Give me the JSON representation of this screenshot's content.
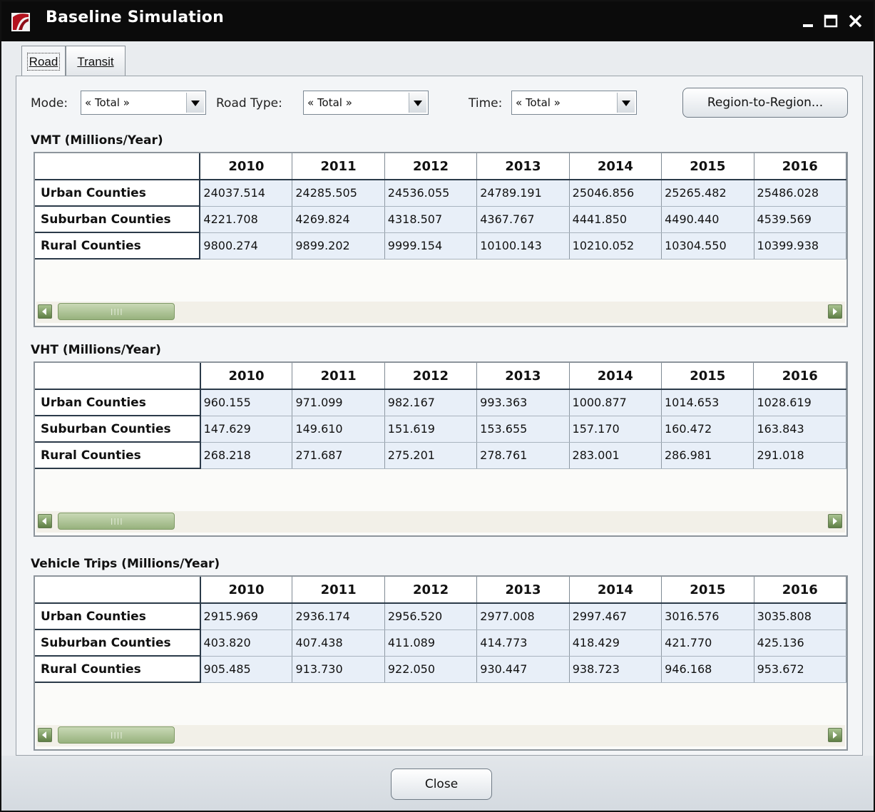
{
  "window": {
    "title": "Baseline Simulation",
    "icon": "app-logo-icon",
    "controls": [
      "minimize-icon",
      "maximize-icon",
      "close-icon"
    ],
    "accent_color": "#0b0b0b"
  },
  "tabs": [
    {
      "label": "Road",
      "active": true
    },
    {
      "label": "Transit",
      "active": false
    }
  ],
  "filters": {
    "mode": {
      "label": "Mode:",
      "value": "« Total »"
    },
    "road_type": {
      "label": "Road Type:",
      "value": "« Total »"
    },
    "time": {
      "label": "Time:",
      "value": "« Total »"
    },
    "region_button": "Region-to-Region..."
  },
  "columns": [
    "2010",
    "2011",
    "2012",
    "2013",
    "2014",
    "2015",
    "2016"
  ],
  "tables": [
    {
      "title": "VMT (Millions/Year)",
      "rows": [
        {
          "label": "Urban Counties",
          "values": [
            "24037.514",
            "24285.505",
            "24536.055",
            "24789.191",
            "25046.856",
            "25265.482",
            "25486.028"
          ]
        },
        {
          "label": "Suburban Counties",
          "values": [
            "4221.708",
            "4269.824",
            "4318.507",
            "4367.767",
            "4441.850",
            "4490.440",
            "4539.569"
          ]
        },
        {
          "label": "Rural Counties",
          "values": [
            "9800.274",
            "9899.202",
            "9999.154",
            "10100.143",
            "10210.052",
            "10304.550",
            "10399.938"
          ]
        }
      ]
    },
    {
      "title": "VHT (Millions/Year)",
      "rows": [
        {
          "label": "Urban Counties",
          "values": [
            "960.155",
            "971.099",
            "982.167",
            "993.363",
            "1000.877",
            "1014.653",
            "1028.619"
          ]
        },
        {
          "label": "Suburban Counties",
          "values": [
            "147.629",
            "149.610",
            "151.619",
            "153.655",
            "157.170",
            "160.472",
            "163.843"
          ]
        },
        {
          "label": "Rural Counties",
          "values": [
            "268.218",
            "271.687",
            "275.201",
            "278.761",
            "283.001",
            "286.981",
            "291.018"
          ]
        }
      ]
    },
    {
      "title": "Vehicle Trips (Millions/Year)",
      "rows": [
        {
          "label": "Urban Counties",
          "values": [
            "2915.969",
            "2936.174",
            "2956.520",
            "2977.008",
            "2997.467",
            "3016.576",
            "3035.808"
          ]
        },
        {
          "label": "Suburban Counties",
          "values": [
            "403.820",
            "407.438",
            "411.089",
            "414.773",
            "418.429",
            "421.770",
            "425.136"
          ]
        },
        {
          "label": "Rural Counties",
          "values": [
            "905.485",
            "913.730",
            "922.050",
            "930.447",
            "938.723",
            "946.168",
            "953.672"
          ]
        }
      ]
    }
  ],
  "footer": {
    "close_label": "Close"
  }
}
